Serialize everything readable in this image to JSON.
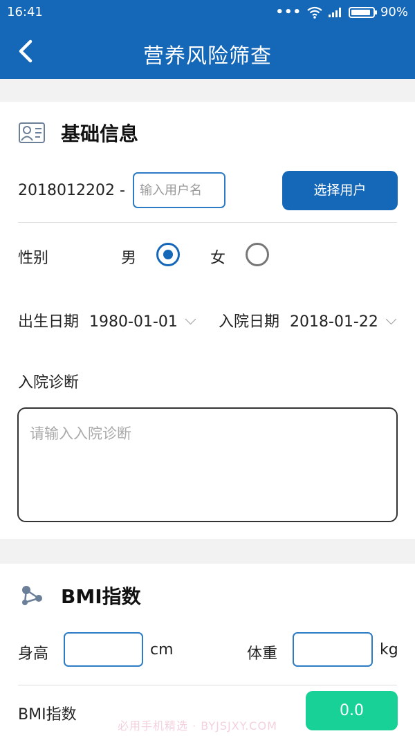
{
  "status_bar": {
    "time": "16:41",
    "battery": "90%",
    "battery_level": 0.9
  },
  "header": {
    "title": "营养风险筛查"
  },
  "basic_info": {
    "section_title": "基础信息",
    "user_id_prefix": "2018012202 -",
    "username_placeholder": "输入用户名",
    "select_user_button": "选择用户",
    "gender_label": "性别",
    "gender_male": "男",
    "gender_female": "女",
    "selected_gender": "male",
    "birth_date_label": "出生日期",
    "birth_date_value": "1980-01-01",
    "admission_date_label": "入院日期",
    "admission_date_value": "2018-01-22",
    "diagnosis_label": "入院诊断",
    "diagnosis_placeholder": "请输入入院诊断"
  },
  "bmi": {
    "section_title": "BMI指数",
    "height_label": "身高",
    "height_unit": "cm",
    "weight_label": "体重",
    "weight_unit": "kg",
    "bmi_label": "BMI指数",
    "bmi_value": "0.0"
  },
  "watermark": "必用手机精选 · BYJSJXY.COM"
}
